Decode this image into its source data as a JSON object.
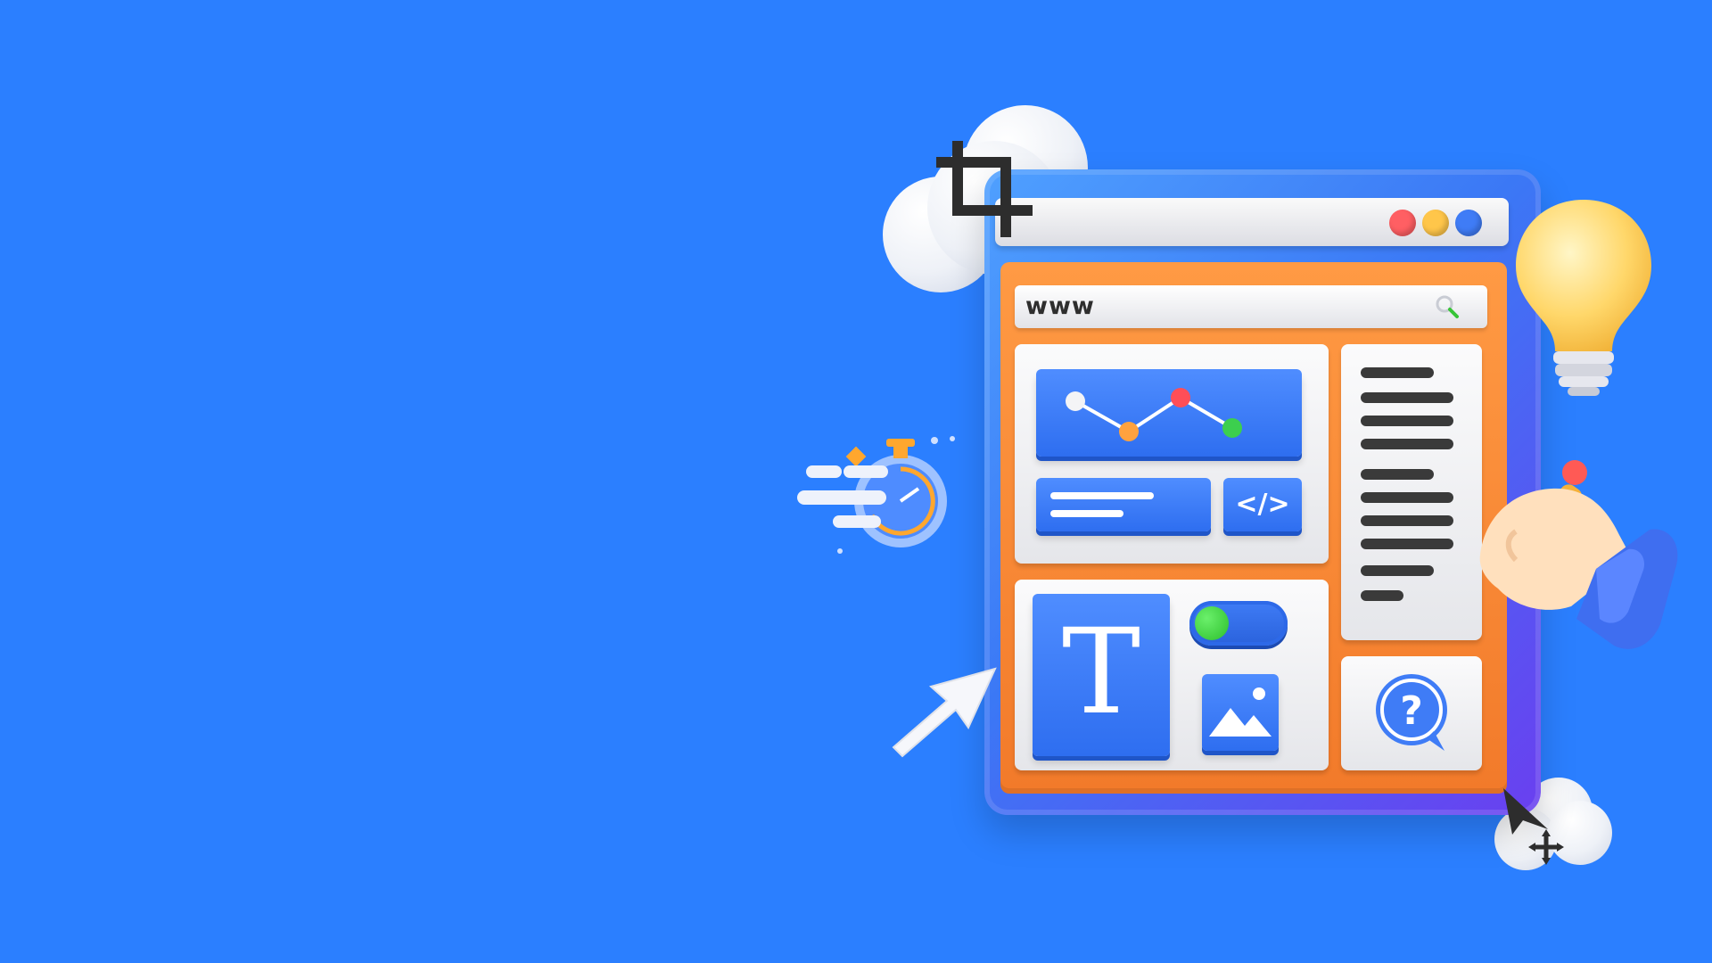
{
  "browser": {
    "url_text": "www",
    "window_dots": [
      "red",
      "yellow",
      "blue"
    ]
  },
  "panels": {
    "code_symbol": "</>",
    "text_symbol": "T",
    "help_symbol": "?"
  },
  "icons": [
    "cloud-icon",
    "crop-icon",
    "stopwatch-icon",
    "light-bulb-icon",
    "hand-with-pencil-icon",
    "arrow-cursor-icon",
    "move-cursor-icon",
    "search-icon",
    "image-icon",
    "toggle-switch-icon",
    "line-chart-icon",
    "help-bubble-icon"
  ],
  "colors": {
    "background": "#2b7fff",
    "frame": "#3b78f5",
    "content": "#f58a35",
    "accent_blue": "#3f7cf6",
    "toggle_on": "#2cbf2c"
  }
}
